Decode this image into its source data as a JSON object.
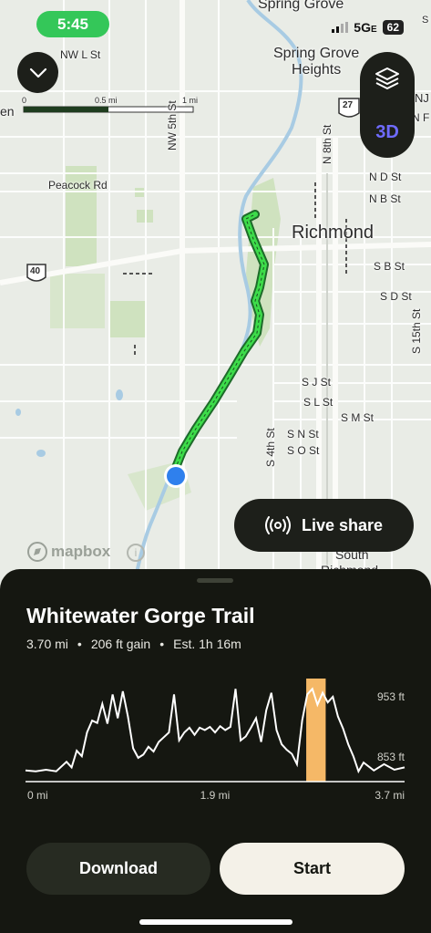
{
  "status": {
    "time": "5:45",
    "network": "5G",
    "network_suffix": "E",
    "battery": "62"
  },
  "map": {
    "labels": {
      "spring_grove": "Spring Grove",
      "spring_grove_heights_1": "Spring Grove",
      "spring_grove_heights_2": "Heights",
      "nw_l_st": "NW L St",
      "en": "en",
      "peacock_rd": "Peacock Rd",
      "nw_5th_st": "NW 5th St",
      "n_8th_st": "N 8th St",
      "n_d_st": "N D St",
      "n_b_st": "N B St",
      "richmond": "Richmond",
      "s_b_st": "S B St",
      "s_d_st": "S D St",
      "s_15th_st": "S 15th St",
      "s_j_st": "S J St",
      "s_l_st": "S L St",
      "s_m_st": "S M St",
      "s_n_st": "S N St",
      "s_o_st": "S O St",
      "s_4th_st": "S 4th St",
      "south_richmond_1": "South",
      "south_richmond_2": "Richmond",
      "route_40": "40",
      "route_27": "27",
      "nj": "NJ",
      "nf": "N F S",
      "s_right": "S"
    },
    "scale": {
      "zero": "0",
      "half": "0.5 mi",
      "one": "1 mi"
    },
    "attribution": "mapbox",
    "three_d_label": "3D",
    "live_share_label": "Live share",
    "accent_trail_color": "#3ddc4a",
    "location_color": "#2f80ed"
  },
  "trail": {
    "title": "Whitewater Gorge Trail",
    "distance": "3.70 mi",
    "gain": "206 ft gain",
    "estimate": "Est. 1h 16m"
  },
  "chart_data": {
    "type": "area",
    "title": "",
    "xlabel": "",
    "ylabel": "",
    "x_ticks": [
      "0 mi",
      "1.9 mi",
      "3.7 mi"
    ],
    "y_ticks": [
      "953 ft",
      "853 ft"
    ],
    "xlim": [
      0,
      3.7
    ],
    "ylim": [
      838,
      968
    ],
    "highlight": {
      "x_start": 2.74,
      "x_end": 2.93,
      "color": "#f5b867"
    },
    "series": [
      {
        "x": [
          0,
          0.1,
          0.2,
          0.3,
          0.4,
          0.45,
          0.5,
          0.55,
          0.6,
          0.65,
          0.7,
          0.75,
          0.8,
          0.85,
          0.9,
          0.95,
          1.0,
          1.05,
          1.1,
          1.15,
          1.2,
          1.25,
          1.3,
          1.35,
          1.4,
          1.45,
          1.5,
          1.55,
          1.6,
          1.65,
          1.7,
          1.75,
          1.8,
          1.85,
          1.9,
          1.95,
          2.0,
          2.05,
          2.1,
          2.15,
          2.2,
          2.25,
          2.3,
          2.35,
          2.4,
          2.45,
          2.5,
          2.55,
          2.6,
          2.65,
          2.7,
          2.75,
          2.8,
          2.85,
          2.9,
          2.95,
          3.0,
          3.05,
          3.1,
          3.15,
          3.2,
          3.25,
          3.3,
          3.4,
          3.5,
          3.6,
          3.7
        ],
        "y": [
          852,
          851,
          853,
          851,
          863,
          856,
          877,
          870,
          900,
          915,
          912,
          936,
          911,
          948,
          918,
          952,
          920,
          880,
          868,
          872,
          882,
          876,
          888,
          894,
          900,
          948,
          890,
          900,
          906,
          897,
          906,
          903,
          907,
          900,
          908,
          903,
          907,
          955,
          890,
          895,
          906,
          918,
          888,
          928,
          950,
          903,
          885,
          878,
          873,
          860,
          915,
          948,
          955,
          935,
          950,
          938,
          945,
          920,
          905,
          885,
          870,
          851,
          862,
          852,
          860,
          853,
          856
        ]
      }
    ],
    "line_color": "#ffffff"
  },
  "actions": {
    "download": "Download",
    "start": "Start"
  }
}
